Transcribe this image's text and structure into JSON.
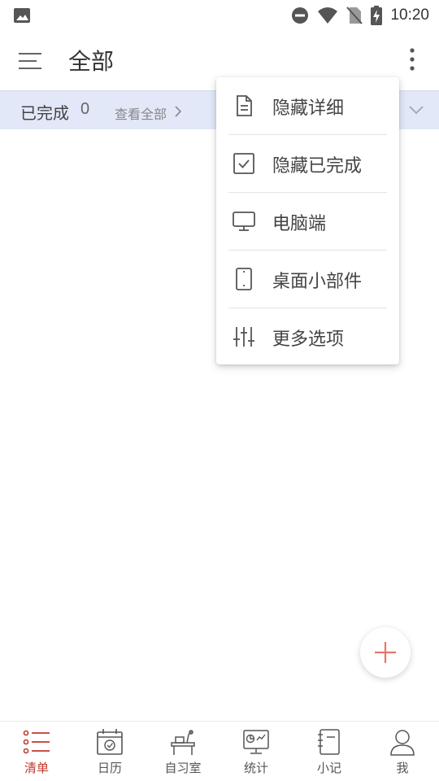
{
  "status_bar": {
    "time": "10:20"
  },
  "header": {
    "title": "全部"
  },
  "completed_row": {
    "label": "已完成",
    "count": "0",
    "view_all": "查看全部"
  },
  "popup_menu": {
    "items": [
      {
        "label": "隐藏详细",
        "icon": "document-icon"
      },
      {
        "label": "隐藏已完成",
        "icon": "checkbox-icon"
      },
      {
        "label": "电脑端",
        "icon": "monitor-icon"
      },
      {
        "label": "桌面小部件",
        "icon": "phone-icon"
      },
      {
        "label": "更多选项",
        "icon": "sliders-icon"
      }
    ]
  },
  "bottom_nav": {
    "items": [
      {
        "label": "清单",
        "icon": "list-icon",
        "active": true
      },
      {
        "label": "日历",
        "icon": "calendar-icon",
        "active": false
      },
      {
        "label": "自习室",
        "icon": "study-room-icon",
        "active": false
      },
      {
        "label": "统计",
        "icon": "statistics-icon",
        "active": false
      },
      {
        "label": "小记",
        "icon": "notebook-icon",
        "active": false
      },
      {
        "label": "我",
        "icon": "profile-icon",
        "active": false
      }
    ]
  },
  "colors": {
    "accent": "#c0392b",
    "completed_row_bg": "#e2e8f8",
    "fab_plus": "#e8766d"
  }
}
